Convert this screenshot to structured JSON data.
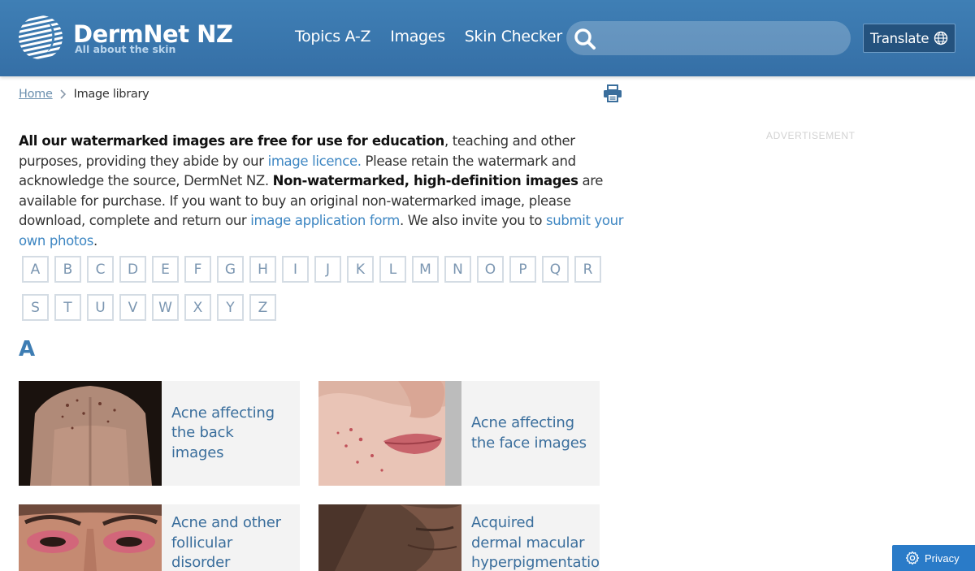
{
  "header": {
    "logo_name": "DermNet NZ",
    "logo_tagline": "All about the skin",
    "nav": [
      "Topics A-Z",
      "Images",
      "Skin Checker"
    ],
    "search_placeholder": "",
    "translate_label": "Translate"
  },
  "breadcrumb": {
    "home": "Home",
    "current": "Image library"
  },
  "advert_label": "ADVERTISEMENT",
  "intro": {
    "b1": "All our watermarked images are free for use for education",
    "t1": ", teaching and other purposes, providing they abide by our ",
    "l1": "image licence.",
    "t2": " Please retain the watermark and acknowledge the source, DermNet NZ. ",
    "b2": "Non-watermarked, high-definition images",
    "t3": " are available for purchase. If you want to buy an original non-watermarked image, please download, complete and return our ",
    "l2": "image application form",
    "t4": ". We also invite you to ",
    "l3": "submit your own photos",
    "t5": "."
  },
  "letters_row1": [
    "A",
    "B",
    "C",
    "D",
    "E",
    "F",
    "G",
    "H",
    "I",
    "J",
    "K",
    "L",
    "M",
    "N",
    "O",
    "P",
    "Q",
    "R"
  ],
  "letters_row2": [
    "S",
    "T",
    "U",
    "V",
    "W",
    "X",
    "Y",
    "Z"
  ],
  "section_heading": "A",
  "cards": [
    {
      "title_lines": [
        "Acne affecting",
        "the back",
        "images"
      ]
    },
    {
      "title_lines": [
        "Acne affecting",
        "the face images"
      ]
    },
    {
      "title_lines": [
        "Acne and other",
        "follicular",
        "disorder"
      ]
    },
    {
      "title_lines": [
        "Acquired",
        "dermal macular",
        "hyperpigmentation"
      ]
    }
  ],
  "privacy_label": "Privacy",
  "colors": {
    "header": "#3f7fb5",
    "link": "#3d86c2",
    "card_title": "#3a6e9c",
    "privacy": "#2a7bc8"
  },
  "icons": {
    "search": "search-icon",
    "translate": "globe-icon",
    "print": "printer-icon",
    "privacy": "gear-icon"
  }
}
